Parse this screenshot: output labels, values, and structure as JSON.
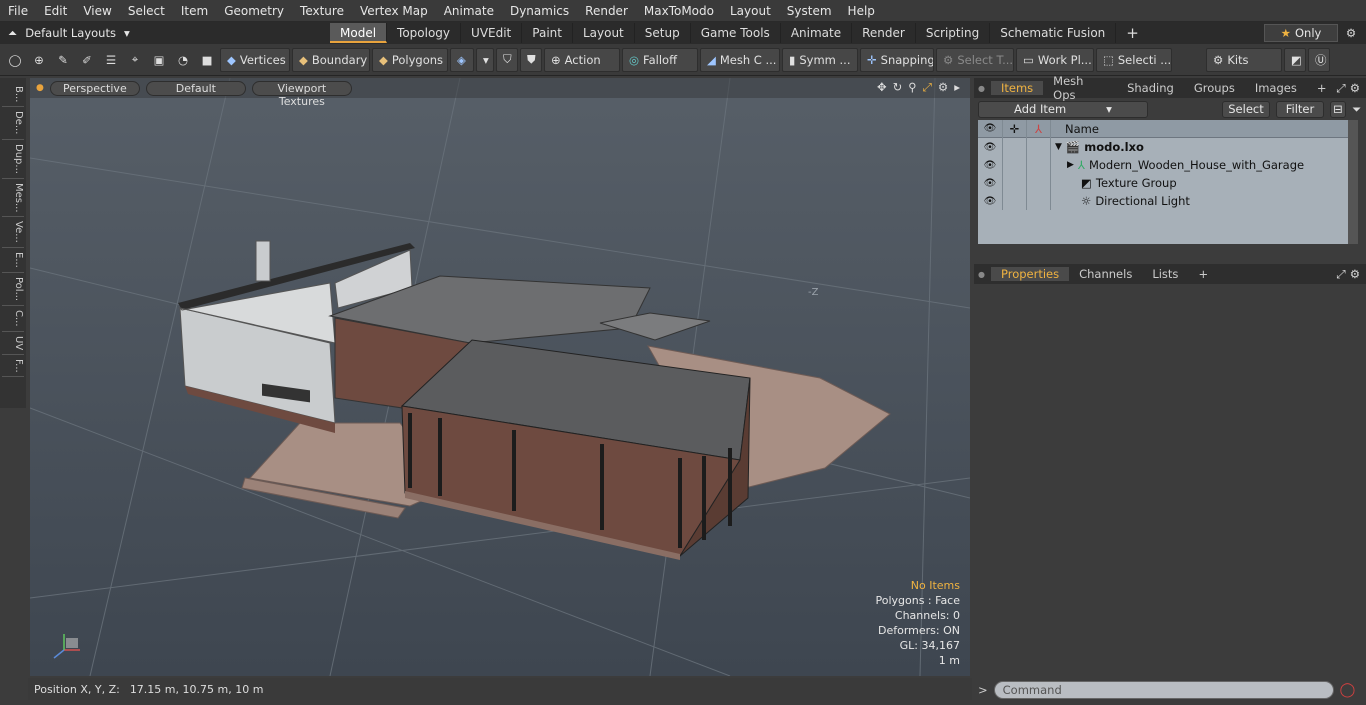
{
  "menu": [
    "File",
    "Edit",
    "View",
    "Select",
    "Item",
    "Geometry",
    "Texture",
    "Vertex Map",
    "Animate",
    "Dynamics",
    "Render",
    "MaxToModo",
    "Layout",
    "System",
    "Help"
  ],
  "layouts_label": "Default Layouts",
  "mode_tabs": [
    "Model",
    "Topology",
    "UVEdit",
    "Paint",
    "Layout",
    "Setup",
    "Game Tools",
    "Animate",
    "Render",
    "Scripting",
    "Schematic Fusion"
  ],
  "active_tab": "Model",
  "only_label": "Only",
  "toolbar": {
    "vertices": "Vertices",
    "boundary": "Boundary",
    "polygons": "Polygons",
    "action": "Action",
    "falloff": "Falloff",
    "mesh": "Mesh C ...",
    "symm": "Symm ...",
    "snapping": "Snapping",
    "select_t": "Select T...",
    "work_pl": "Work Pl...",
    "selecti": "Selecti ...",
    "kits": "Kits"
  },
  "side_tabs": [
    "B...",
    "De...",
    "Dup...",
    "Mes...",
    "Ve...",
    "E...",
    "Pol...",
    "C...",
    "UV",
    "F..."
  ],
  "viewport": {
    "perspective": "Perspective",
    "default": "Default",
    "textures": "Viewport Textures",
    "axis_label": "-Z",
    "info": {
      "no_items": "No Items",
      "polygons": "Polygons : Face",
      "channels": "Channels: 0",
      "deformers": "Deformers: ON",
      "gl": "GL: 34,167",
      "scale": "1 m"
    }
  },
  "status": {
    "label": "Position X, Y, Z:",
    "value": "17.15 m, 10.75 m, 10 m"
  },
  "items_panel": {
    "tabs": [
      "Items",
      "Mesh Ops",
      "Shading",
      "Groups",
      "Images"
    ],
    "add_item": "Add Item",
    "select": "Select",
    "filter": "Filter",
    "name_header": "Name",
    "rows": [
      "modo.lxo",
      "Modern_Wooden_House_with_Garage",
      "Texture Group",
      "Directional Light"
    ]
  },
  "props_panel": {
    "tabs": [
      "Properties",
      "Channels",
      "Lists"
    ]
  },
  "command": {
    "placeholder": "Command"
  },
  "colors": {
    "accent": "#e8a33d",
    "warn": "#f0b341",
    "viewport_bg": "#4a535c"
  }
}
